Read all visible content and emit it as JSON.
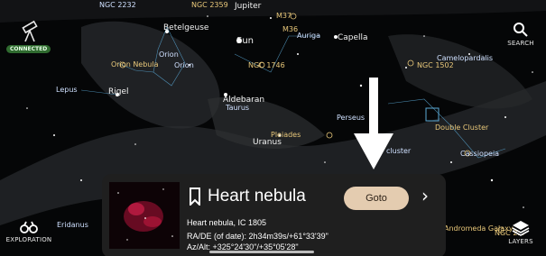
{
  "status": {
    "connected": "CONNECTED"
  },
  "toolbar": {
    "search_label": "SEARCH",
    "exploration_label": "EXPLORATION",
    "layers_label": "LAYERS"
  },
  "sky_labels": [
    "NGC 2232",
    "NGC 2359",
    "Jupiter",
    "M37",
    "M36",
    "Auriga",
    "Capella",
    "Betelgeuse",
    "Sun",
    "Orion",
    "Orion Nebula",
    "Orion",
    "NGC 1746",
    "Camelopardalis",
    "NGC 1502",
    "Lepus",
    "Rigel",
    "Aldebaran",
    "Taurus",
    "Perseus",
    "Pleiades",
    "Uranus",
    "Double Cluster",
    "cluster",
    "Cassiopeia",
    "Eridanus",
    "Andromeda Galaxy",
    "NGC 2..."
  ],
  "card": {
    "title": "Heart nebula",
    "goto_label": "Goto",
    "chevron": "›",
    "subtitle": "Heart nebula,  IC 1805",
    "ra_dec": "RA/DE (of date): 2h34m39s/+61°33'39\"",
    "az_alt": "Az/Alt: +325°24'30\"/+35°05'28\""
  },
  "colors": {
    "accent_connected": "#2f6a2f",
    "goto_bg": "#e4ccb0",
    "card_bg": "#1f1f1f"
  }
}
